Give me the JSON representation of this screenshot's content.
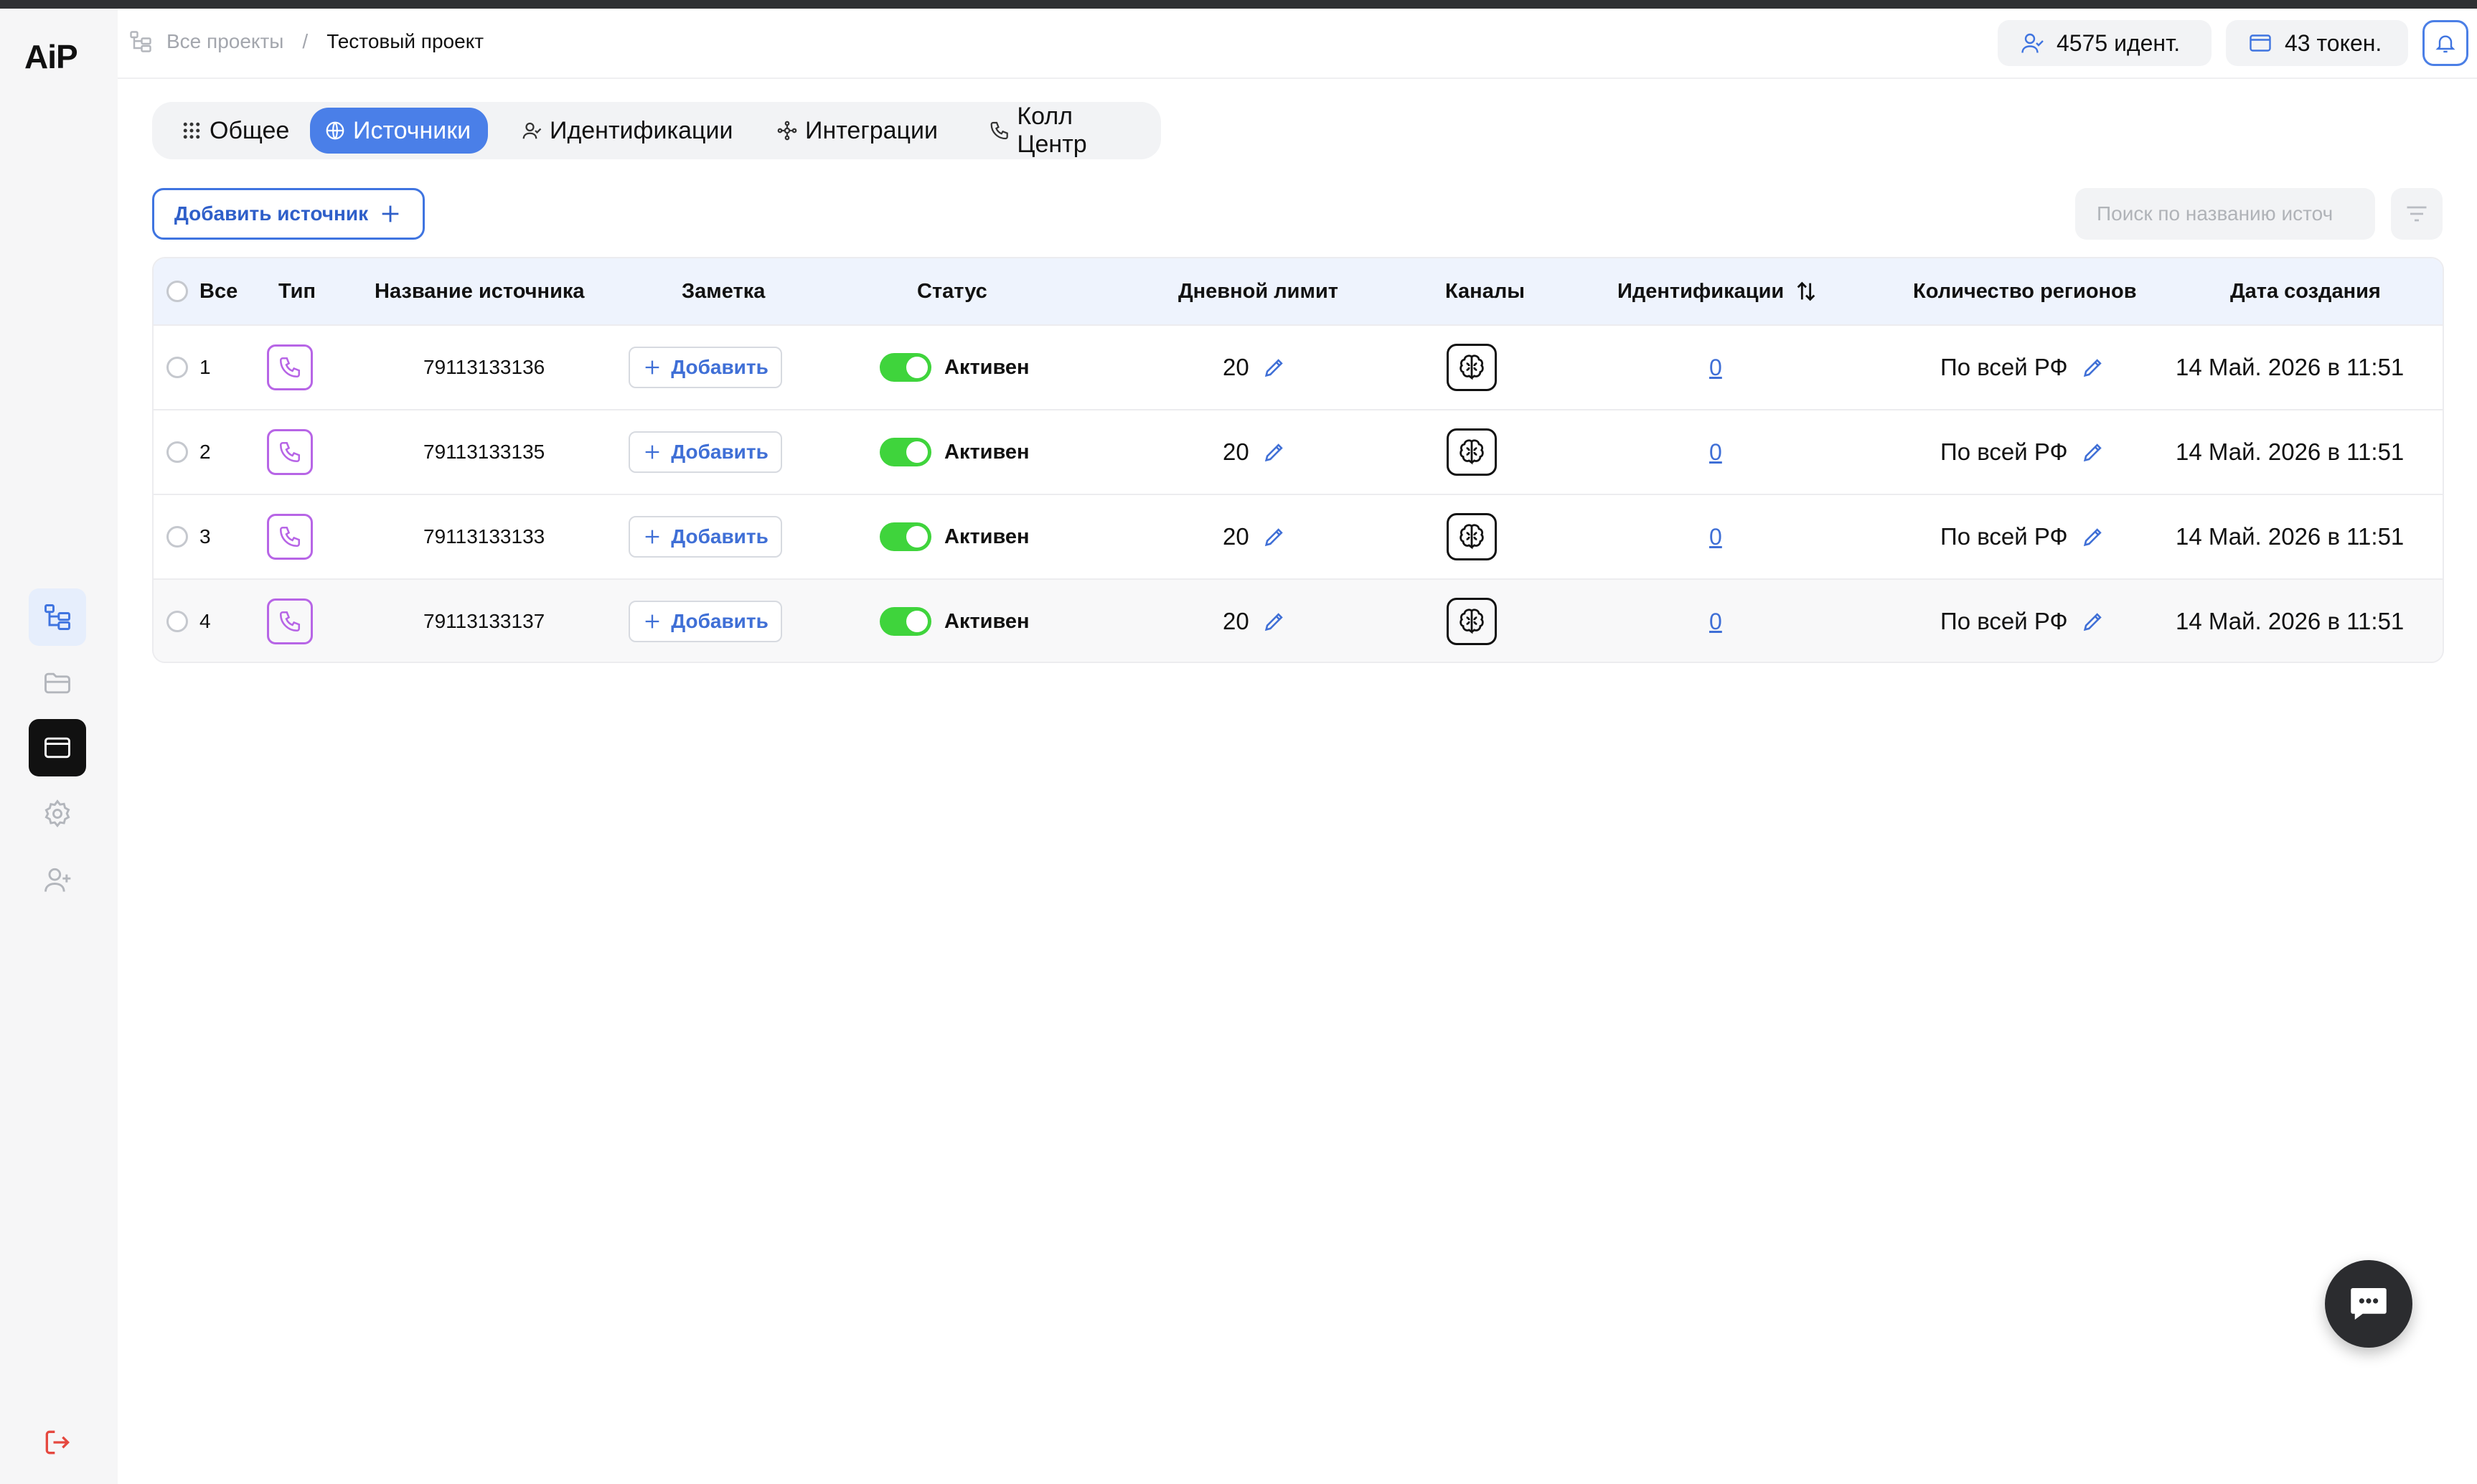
{
  "app": {
    "logo_text": "AiP"
  },
  "header": {
    "breadcrumb": {
      "root": "Все проекты",
      "separator": "/",
      "current": "Тестовый проект"
    },
    "identifications_pill": "4575 идент.",
    "tokens_pill": "43 токен."
  },
  "tabs": [
    {
      "label": "Общее",
      "icon": "grid-icon",
      "active": false
    },
    {
      "label": "Источники",
      "icon": "globe-icon",
      "active": true
    },
    {
      "label": "Идентификации",
      "icon": "user-check-icon",
      "active": false
    },
    {
      "label": "Интеграции",
      "icon": "network-icon",
      "active": false
    },
    {
      "label": "Колл Центр",
      "icon": "phone-icon",
      "active": false
    }
  ],
  "toolbar": {
    "add_source_label": "Добавить источник",
    "search_placeholder": "Поиск по названию источ"
  },
  "table": {
    "headers": {
      "all": "Все",
      "type": "Тип",
      "name": "Название источника",
      "note": "Заметка",
      "status": "Статус",
      "daily_limit": "Дневной лимит",
      "channels": "Каналы",
      "identifications": "Идентификации",
      "regions": "Количество регионов",
      "created": "Дата создания"
    },
    "rows": [
      {
        "index": "1",
        "name": "79113133136",
        "note": "Добавить",
        "status": "Активен",
        "limit": "20",
        "identifications": "0",
        "regions": "По всей РФ",
        "created": "14 Май. 2026 в 11:51"
      },
      {
        "index": "2",
        "name": "79113133135",
        "note": "Добавить",
        "status": "Активен",
        "limit": "20",
        "identifications": "0",
        "regions": "По всей РФ",
        "created": "14 Май. 2026 в 11:51"
      },
      {
        "index": "3",
        "name": "79113133133",
        "note": "Добавить",
        "status": "Активен",
        "limit": "20",
        "identifications": "0",
        "regions": "По всей РФ",
        "created": "14 Май. 2026 в 11:51"
      },
      {
        "index": "4",
        "name": "79113133137",
        "note": "Добавить",
        "status": "Активен",
        "limit": "20",
        "identifications": "0",
        "regions": "По всей РФ",
        "created": "14 Май. 2026 в 11:51"
      }
    ]
  },
  "colors": {
    "accent": "#4a7fe8",
    "toggle_on": "#3fd43c",
    "type_icon": "#b765e6",
    "logout": "#e5483f"
  }
}
